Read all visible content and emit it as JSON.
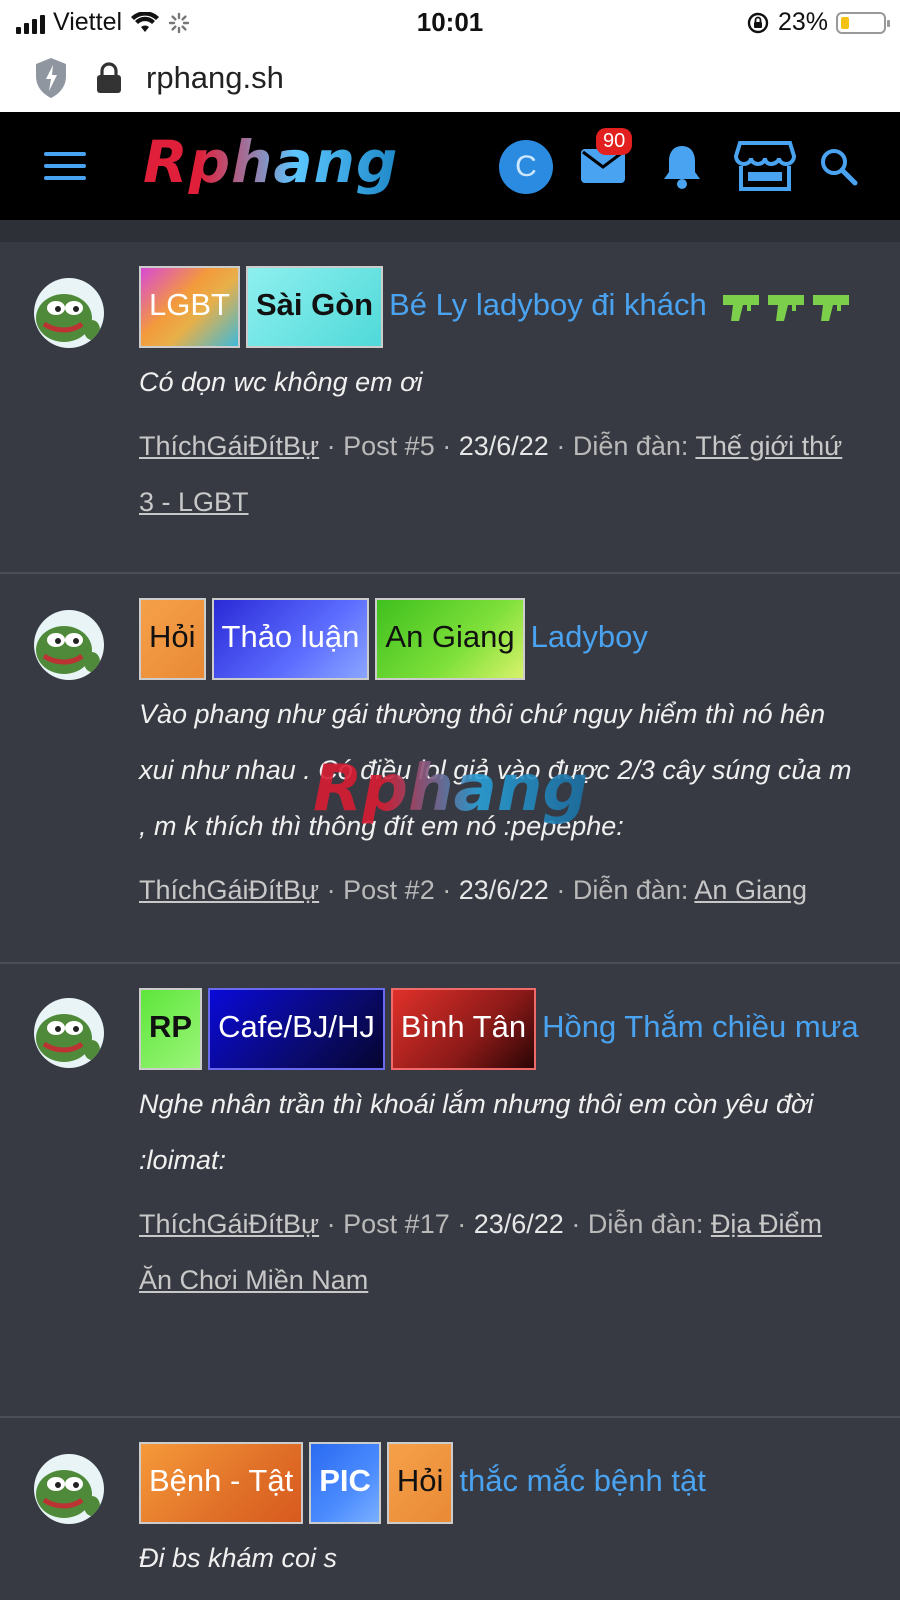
{
  "status_bar": {
    "carrier": "Viettel",
    "time": "10:01",
    "battery": "23%"
  },
  "address_bar": {
    "url": "rphang.sh"
  },
  "header": {
    "logo_text": "Rphang",
    "avatar_letter": "C",
    "mail_count": "90",
    "accent_color": "#4aa3f0"
  },
  "watermark": "Rphang",
  "results": [
    {
      "tags": [
        {
          "label": "LGBT",
          "style": "rainbow"
        },
        {
          "label": "Sài Gòn",
          "style": "cyan"
        }
      ],
      "title": "Bé Ly ladyboy đi khách",
      "title_suffix_icons": [
        "water-gun-icon",
        "water-gun-icon",
        "water-gun-icon"
      ],
      "snippet": "Có dọn wc không em ơi",
      "author": "ThíchGáiĐítBự",
      "post": "· Post #5 ·",
      "date": "23/6/22",
      "forum_label": "· Diễn đàn:",
      "forum": "Thế giới thứ 3 - LGBT"
    },
    {
      "tags": [
        {
          "label": "Hỏi",
          "style": "orange"
        },
        {
          "label": "Thảo luận",
          "style": "blue"
        },
        {
          "label": "An Giang",
          "style": "green"
        }
      ],
      "title": "Ladyboy",
      "snippet": "Vào phang như gái thường thôi chứ nguy hiểm thì nó hên xui như nhau . Có điều lol giả vào được 2/3 cây súng của m , m k thích thì thông đít em nó :pepephe:",
      "author": "ThíchGáiĐítBự",
      "post": "· Post #2 ·",
      "date": "23/6/22",
      "forum_label": "· Diễn đàn:",
      "forum": "An Giang"
    },
    {
      "tags": [
        {
          "label": "RP",
          "style": "lime"
        },
        {
          "label": "Cafe/BJ/HJ",
          "style": "navy"
        },
        {
          "label": "Bình Tân",
          "style": "red"
        }
      ],
      "title": "Hồng Thắm chiều mưa",
      "snippet": "Nghe nhân trần thì khoái lắm nhưng thôi em còn yêu đời :loimat:",
      "author": "ThíchGáiĐítBự",
      "post": "· Post #17 ·",
      "date": "23/6/22",
      "forum_label": "· Diễn đàn:",
      "forum": "Địa Điểm Ăn Chơi Miền Nam"
    },
    {
      "tags": [
        {
          "label": "Bệnh - Tật",
          "style": "orange2"
        },
        {
          "label": "PIC",
          "style": "bluepic"
        },
        {
          "label": "Hỏi",
          "style": "orange"
        }
      ],
      "title": "thắc mắc bệnh tật",
      "snippet": "Đi bs khám coi s"
    }
  ]
}
